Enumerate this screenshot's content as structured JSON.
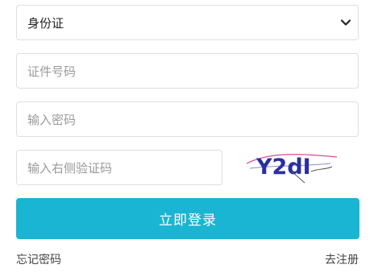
{
  "id_type": {
    "selected": "身份证"
  },
  "fields": {
    "id_number_placeholder": "证件号码",
    "password_placeholder": "输入密码",
    "captcha_placeholder": "输入右侧验证码"
  },
  "captcha": {
    "text": "Y2dI"
  },
  "buttons": {
    "login": "立即登录"
  },
  "links": {
    "forgot_password": "忘记密码",
    "register": "去注册"
  },
  "colors": {
    "primary": "#1ab5d2",
    "captcha_text": "#2a2fa0"
  },
  "icons": {
    "select_arrow": "chevron-down-icon"
  }
}
